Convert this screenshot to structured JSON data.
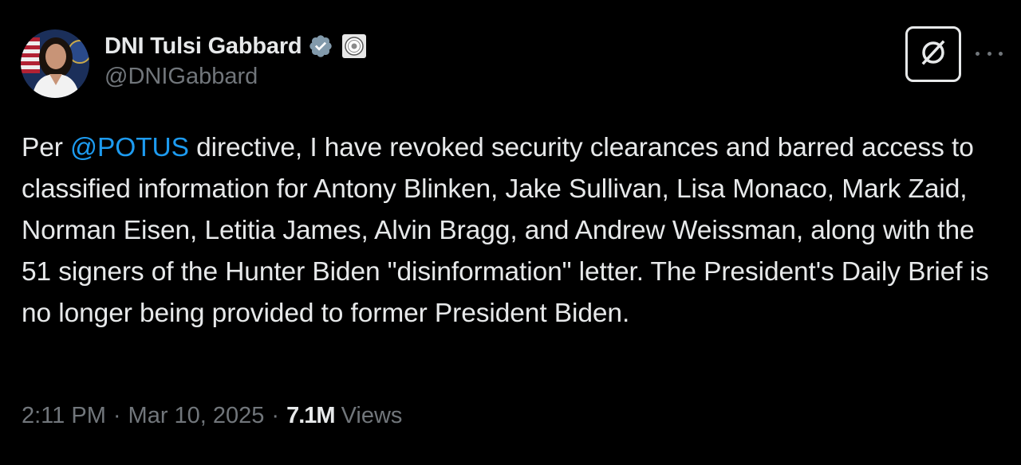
{
  "author": {
    "display_name": "DNI Tulsi Gabbard",
    "handle": "@DNIGabbard",
    "verified_icon": "verified-badge-icon",
    "affiliation_icon": "government-seal-icon"
  },
  "actions": {
    "grok_icon": "grok-icon",
    "more_icon": "more-options-icon"
  },
  "tweet": {
    "text_before": "Per ",
    "mention": "@POTUS",
    "text_after": " directive, I have revoked security clearances and barred access to classified information for Antony Blinken, Jake Sullivan, Lisa Monaco, Mark Zaid, Norman Eisen, Letitia James, Alvin Bragg, and Andrew Weissman, along with the 51 signers of the Hunter Biden \"disinformation\" letter. The President's Daily Brief is no longer being provided to former President Biden."
  },
  "meta": {
    "time": "2:11 PM",
    "separator": "·",
    "date": "Mar 10, 2025",
    "views_count": "7.1M",
    "views_label": "Views"
  },
  "colors": {
    "background": "#000000",
    "text": "#e7e9ea",
    "secondary": "#71767b",
    "link": "#1d9bf0",
    "verified": "#829aab"
  }
}
